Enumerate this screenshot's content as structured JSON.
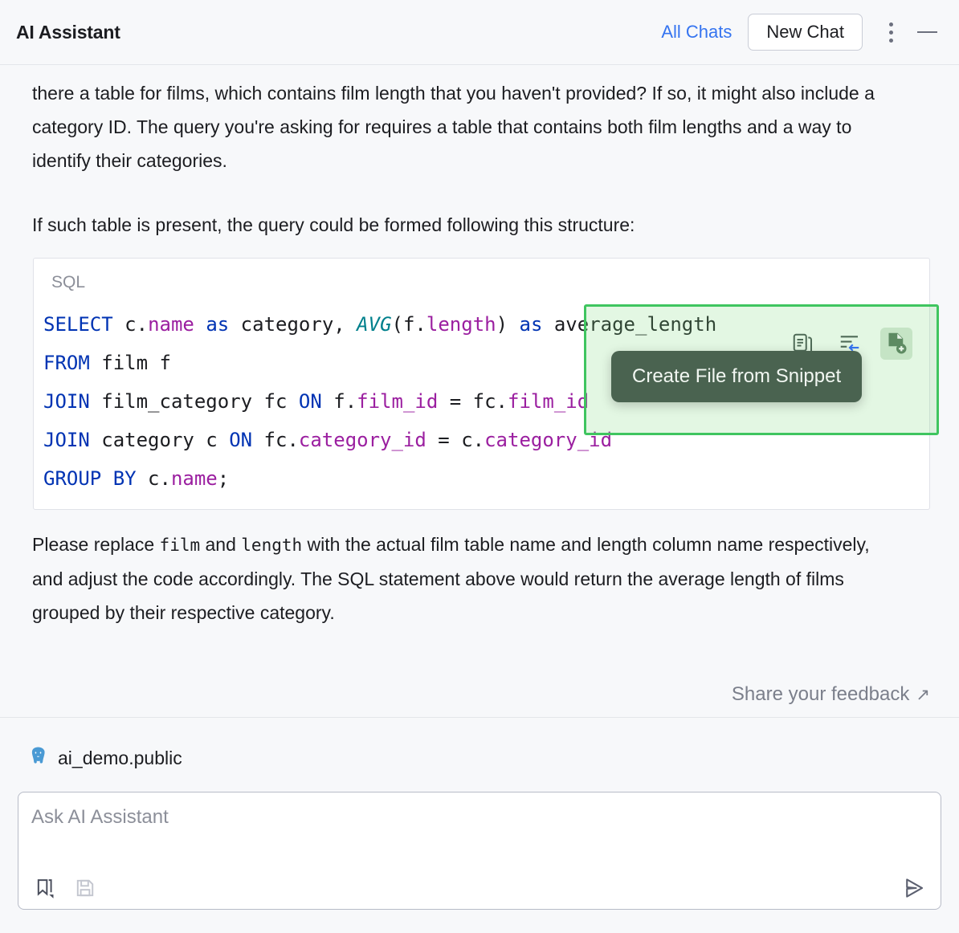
{
  "header": {
    "title": "AI Assistant",
    "all_chats_label": "All Chats",
    "new_chat_label": "New Chat",
    "more_icon": "kebab-menu-icon",
    "minimize_icon": "minimize-icon"
  },
  "chat": {
    "paragraph_1": "there a table for films, which contains film length that you haven't provided? If so, it might also include a category ID. The query you're asking for requires a table that contains both film lengths and a way to identify their categories.",
    "paragraph_2": "If such table is present, the query could be formed following this structure:",
    "code": {
      "language_label": "SQL",
      "lines": [
        [
          {
            "t": "SELECT",
            "c": "kw"
          },
          {
            "t": " c.",
            "c": "pl"
          },
          {
            "t": "name",
            "c": "col"
          },
          {
            "t": " ",
            "c": "pl"
          },
          {
            "t": "as",
            "c": "kw"
          },
          {
            "t": " category, ",
            "c": "pl"
          },
          {
            "t": "AVG",
            "c": "fn"
          },
          {
            "t": "(f.",
            "c": "pl"
          },
          {
            "t": "length",
            "c": "col"
          },
          {
            "t": ") ",
            "c": "pl"
          },
          {
            "t": "as",
            "c": "kw"
          },
          {
            "t": " average_length",
            "c": "pl"
          }
        ],
        [
          {
            "t": "FROM",
            "c": "kw"
          },
          {
            "t": " film f",
            "c": "pl"
          }
        ],
        [
          {
            "t": "JOIN",
            "c": "kw"
          },
          {
            "t": " film_category fc ",
            "c": "pl"
          },
          {
            "t": "ON",
            "c": "kw"
          },
          {
            "t": " f.",
            "c": "pl"
          },
          {
            "t": "film_id",
            "c": "col"
          },
          {
            "t": " = fc.",
            "c": "pl"
          },
          {
            "t": "film_id",
            "c": "col"
          }
        ],
        [
          {
            "t": "JOIN",
            "c": "kw"
          },
          {
            "t": " category c ",
            "c": "pl"
          },
          {
            "t": "ON",
            "c": "kw"
          },
          {
            "t": " fc.",
            "c": "pl"
          },
          {
            "t": "category_id",
            "c": "col"
          },
          {
            "t": " = c.",
            "c": "pl"
          },
          {
            "t": "category_id",
            "c": "col"
          }
        ],
        [
          {
            "t": "GROUP BY",
            "c": "kw"
          },
          {
            "t": " c.",
            "c": "pl"
          },
          {
            "t": "name",
            "c": "col"
          },
          {
            "t": ";",
            "c": "pl"
          }
        ]
      ],
      "toolbar": [
        {
          "icon": "copy-snippet-icon",
          "active": false
        },
        {
          "icon": "insert-into-editor-icon",
          "active": false
        },
        {
          "icon": "create-file-from-snippet-icon",
          "active": true
        }
      ],
      "highlight_color": "#3fc55f",
      "highlight_fill": "#ddf2dd"
    },
    "tooltip": "Create File from Snippet",
    "paragraph_3_parts": {
      "a": "Please replace ",
      "code1": "film",
      "b": " and ",
      "code2": "length",
      "c": " with the actual film table name and length column name respectively, and adjust the code accordingly. The SQL statement above would return the average length of films grouped by their respective category."
    },
    "feedback_label": "Share your feedback",
    "feedback_arrow": "↗"
  },
  "footer": {
    "db_icon": "postgresql-elephant-icon",
    "db_context": "ai_demo.public",
    "input_placeholder": "Ask AI Assistant",
    "bookmark_icon": "snippet-bookmark-icon",
    "save_icon": "save-floppy-icon",
    "send_icon": "send-arrow-icon"
  }
}
